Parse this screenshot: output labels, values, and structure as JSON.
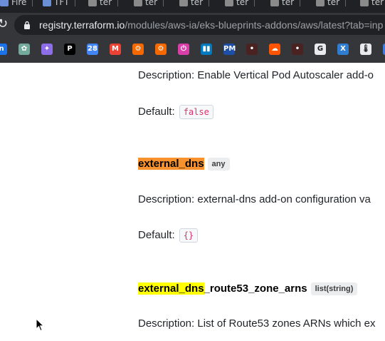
{
  "browser": {
    "tabs": [
      {
        "title": "Fire"
      },
      {
        "title": "TFT"
      },
      {
        "title": "ter"
      },
      {
        "title": "ter"
      },
      {
        "title": "ter"
      },
      {
        "title": "ter"
      },
      {
        "title": "ter"
      },
      {
        "title": "ter"
      },
      {
        "title": "ter"
      }
    ],
    "url_host": "registry.terraform.io",
    "url_path": "/modules/aws-ia/eks-blueprints-addons/aws/latest?tab=inp",
    "bookmarks": [
      {
        "icon": "bookmark-app-icon",
        "color": "#1a73e8",
        "glyph": "n"
      },
      {
        "icon": "chatgpt-icon",
        "color": "#74aa9c",
        "glyph": "✿"
      },
      {
        "icon": "gemini-icon",
        "color": "#8e6ee8",
        "glyph": "✦"
      },
      {
        "icon": "p-app-icon",
        "color": "#000000",
        "glyph": "P"
      },
      {
        "icon": "calendar-icon",
        "color": "#4285f4",
        "glyph": "28"
      },
      {
        "icon": "gmail-icon",
        "color": "#ea4335",
        "glyph": "M"
      },
      {
        "icon": "grafana-icon",
        "color": "#f46800",
        "glyph": "⚙"
      },
      {
        "icon": "grafana-icon",
        "color": "#f46800",
        "glyph": "⚙"
      },
      {
        "icon": "power-icon",
        "color": "#d93fa8",
        "glyph": "⏻"
      },
      {
        "icon": "trello-icon",
        "color": "#0079bf",
        "glyph": "▮▮"
      },
      {
        "icon": "pm-app-icon",
        "color": "#1d4ea8",
        "glyph": "PM"
      },
      {
        "icon": "bookmark-app-icon",
        "color": "#4a2222",
        "glyph": "•"
      },
      {
        "icon": "soundcloud-icon",
        "color": "#ff5500",
        "glyph": "☁"
      },
      {
        "icon": "bookmark-app-icon",
        "color": "#4a2222",
        "glyph": "•"
      },
      {
        "icon": "ga-app-icon",
        "color": "#e8eaed",
        "glyph": "G"
      },
      {
        "icon": "x-app-icon",
        "color": "#2e7dd1",
        "glyph": "X"
      },
      {
        "icon": "thermometer-icon",
        "color": "#e8eaed",
        "glyph": "🌡"
      },
      {
        "icon": "bookmark-app-icon",
        "color": "#3b7ddd",
        "glyph": "■"
      }
    ]
  },
  "page": {
    "vpa_description": "Description: Enable Vertical Pod Autoscaler add-o",
    "vpa_default_label": "Default:",
    "vpa_default_value": "false",
    "external_dns": {
      "name": "external_dns",
      "type": "any",
      "description": "Description: external-dns add-on configuration va",
      "default_label": "Default:",
      "default_value": "{}"
    },
    "zone_arns": {
      "name_highlight": "external_dns",
      "name_rest": "_route53_zone_arns",
      "type": "list(string)",
      "description": "Description: List of Route53 zones ARNs which ex"
    }
  }
}
